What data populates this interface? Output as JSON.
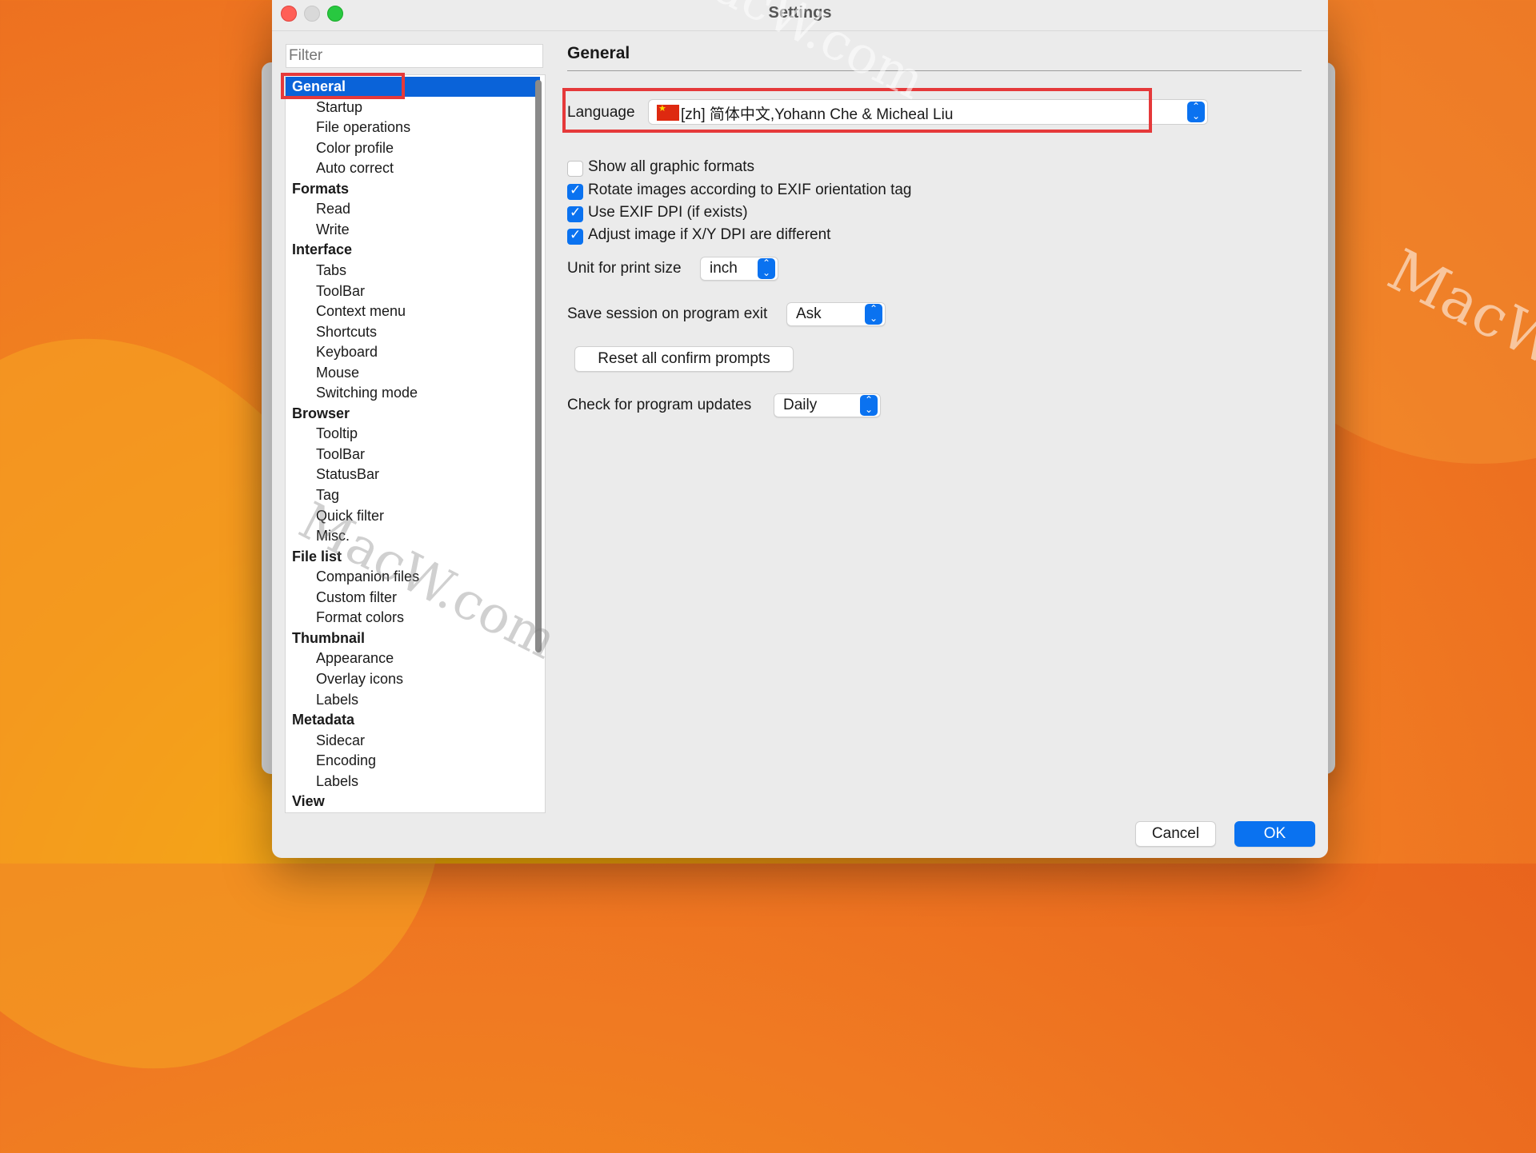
{
  "window": {
    "title": "Settings"
  },
  "sidebar": {
    "filter_placeholder": "Filter",
    "items": [
      {
        "label": "General",
        "kind": "cat",
        "selected": true
      },
      {
        "label": "Startup",
        "kind": "sub"
      },
      {
        "label": "File operations",
        "kind": "sub"
      },
      {
        "label": "Color profile",
        "kind": "sub"
      },
      {
        "label": "Auto correct",
        "kind": "sub"
      },
      {
        "label": "Formats",
        "kind": "cat"
      },
      {
        "label": "Read",
        "kind": "sub"
      },
      {
        "label": "Write",
        "kind": "sub"
      },
      {
        "label": "Interface",
        "kind": "cat"
      },
      {
        "label": "Tabs",
        "kind": "sub"
      },
      {
        "label": "ToolBar",
        "kind": "sub"
      },
      {
        "label": "Context menu",
        "kind": "sub"
      },
      {
        "label": "Shortcuts",
        "kind": "sub"
      },
      {
        "label": "Keyboard",
        "kind": "sub"
      },
      {
        "label": "Mouse",
        "kind": "sub"
      },
      {
        "label": "Switching mode",
        "kind": "sub"
      },
      {
        "label": "Browser",
        "kind": "cat"
      },
      {
        "label": "Tooltip",
        "kind": "sub"
      },
      {
        "label": "ToolBar",
        "kind": "sub"
      },
      {
        "label": "StatusBar",
        "kind": "sub"
      },
      {
        "label": "Tag",
        "kind": "sub"
      },
      {
        "label": "Quick filter",
        "kind": "sub"
      },
      {
        "label": "Misc.",
        "kind": "sub"
      },
      {
        "label": "File list",
        "kind": "cat"
      },
      {
        "label": "Companion files",
        "kind": "sub"
      },
      {
        "label": "Custom filter",
        "kind": "sub"
      },
      {
        "label": "Format colors",
        "kind": "sub"
      },
      {
        "label": "Thumbnail",
        "kind": "cat"
      },
      {
        "label": "Appearance",
        "kind": "sub"
      },
      {
        "label": "Overlay icons",
        "kind": "sub"
      },
      {
        "label": "Labels",
        "kind": "sub"
      },
      {
        "label": "Metadata",
        "kind": "cat"
      },
      {
        "label": "Sidecar",
        "kind": "sub"
      },
      {
        "label": "Encoding",
        "kind": "sub"
      },
      {
        "label": "Labels",
        "kind": "sub"
      },
      {
        "label": "View",
        "kind": "cat"
      }
    ]
  },
  "general": {
    "title": "General",
    "language_label": "Language",
    "language_value": "[zh] 简体中文,Yohann Che & Micheal Liu",
    "checkboxes": [
      {
        "label": "Show all graphic formats",
        "checked": false
      },
      {
        "label": "Rotate images according to EXIF orientation tag",
        "checked": true
      },
      {
        "label": "Use EXIF DPI (if exists)",
        "checked": true
      },
      {
        "label": "Adjust image if X/Y DPI are different",
        "checked": true
      }
    ],
    "print_unit_label": "Unit for print size",
    "print_unit_value": "inch",
    "save_session_label": "Save session on program exit",
    "save_session_value": "Ask",
    "reset_prompts_label": "Reset all confirm prompts",
    "updates_label": "Check for program updates",
    "updates_value": "Daily"
  },
  "footer": {
    "cancel_label": "Cancel",
    "ok_label": "OK"
  },
  "colors": {
    "accent": "#0a72f0",
    "highlight": "#e5393a",
    "selection": "#0a63d9"
  },
  "watermark": {
    "text": "MacW.com"
  }
}
